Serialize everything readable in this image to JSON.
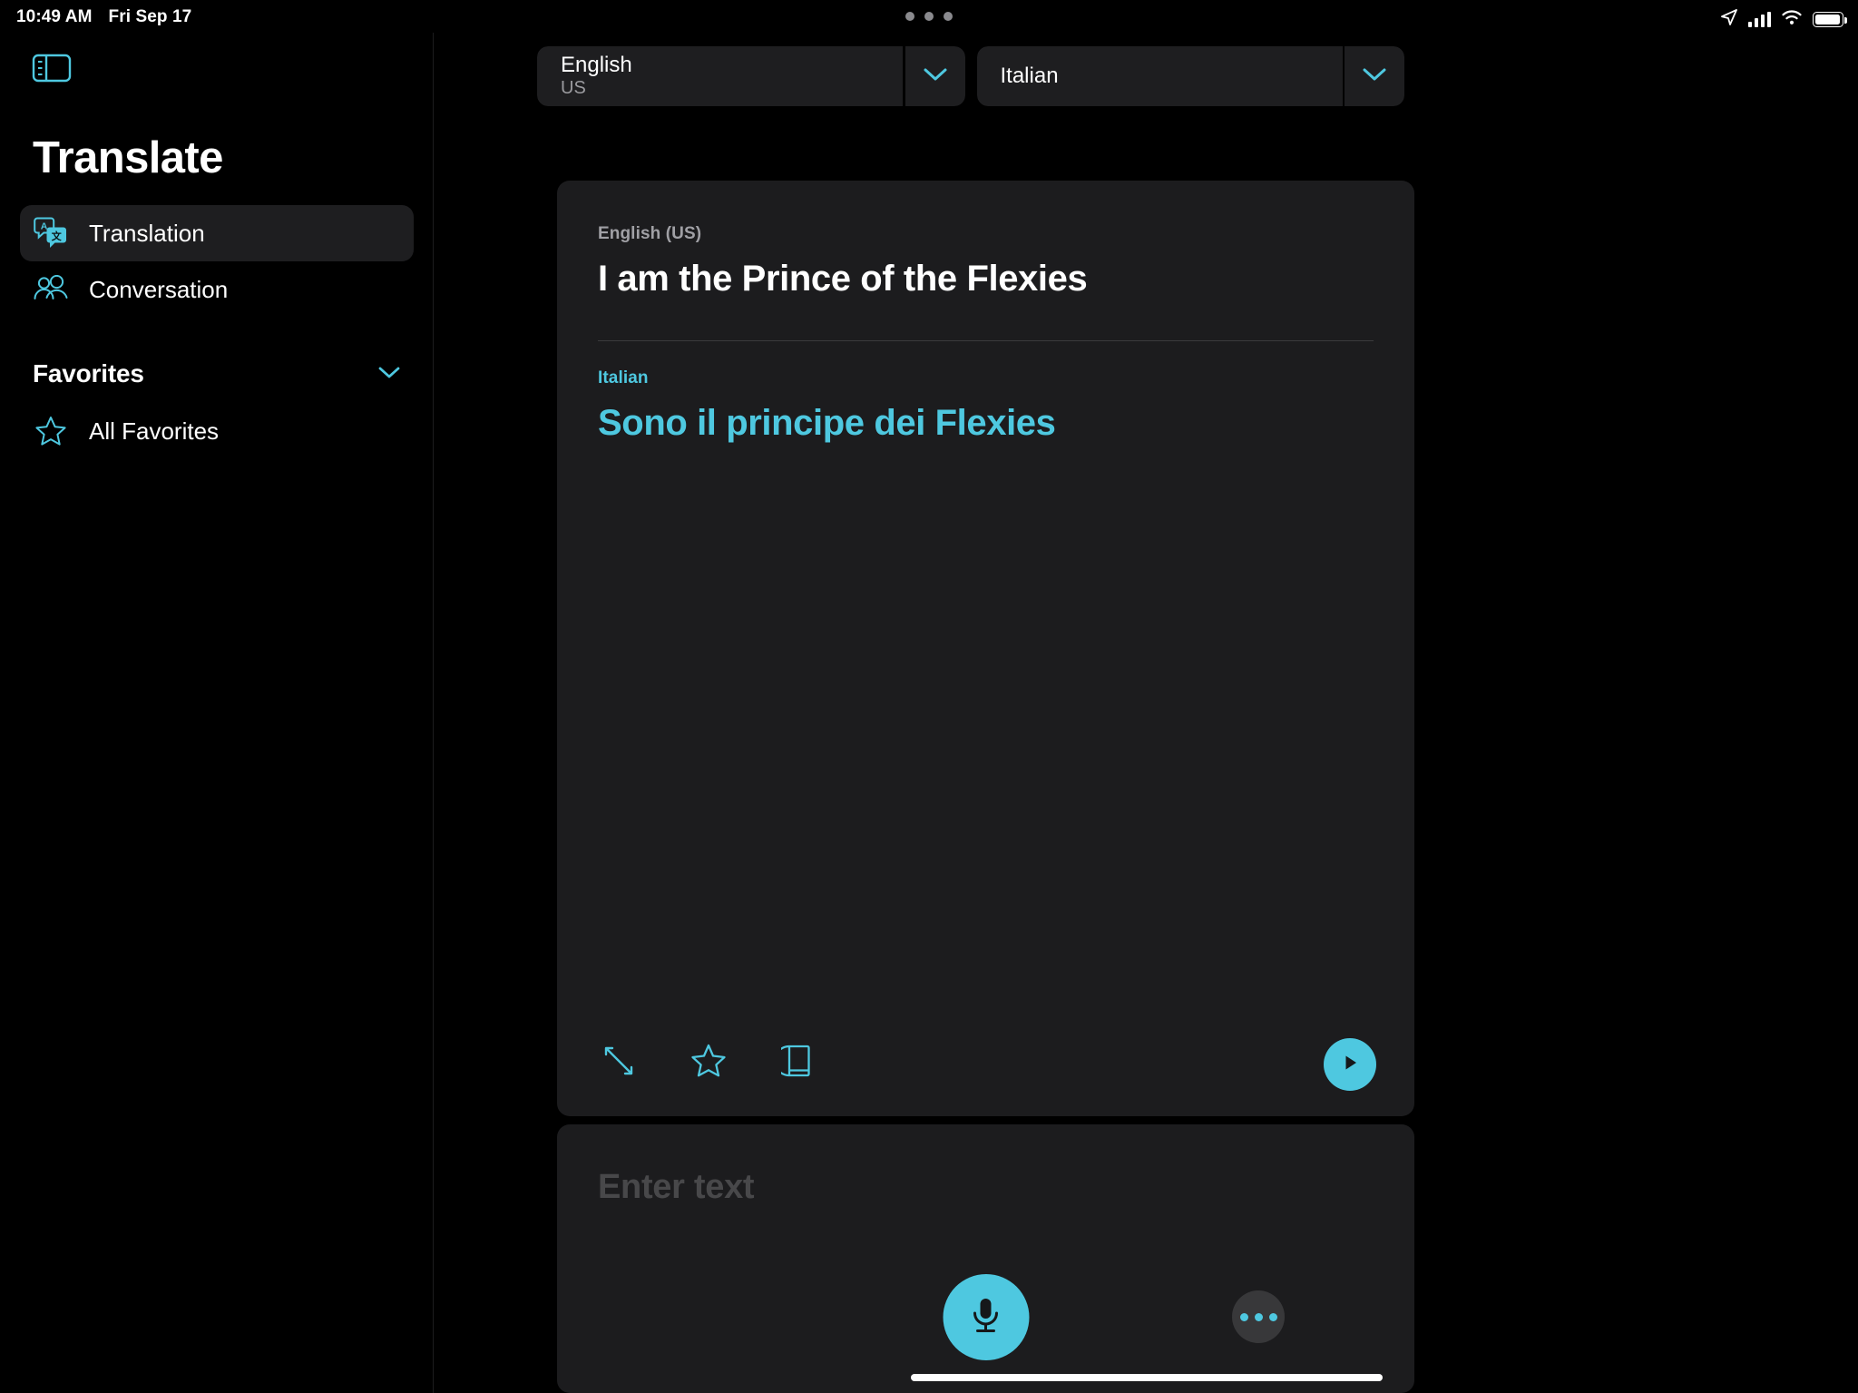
{
  "status_bar": {
    "time": "10:49 AM",
    "date": "Fri Sep 17",
    "icons": [
      "location-arrow-icon",
      "cellular-bars-icon",
      "wifi-icon",
      "battery-icon"
    ],
    "multitask_dots": "•••"
  },
  "sidebar": {
    "toggle_icon": "sidebar-toggle-icon",
    "title": "Translate",
    "items": [
      {
        "label": "Translation",
        "icon": "translation-bubbles-icon",
        "selected": true
      },
      {
        "label": "Conversation",
        "icon": "two-people-icon",
        "selected": false
      }
    ],
    "favorites": {
      "header": "Favorites",
      "chevron_icon": "chevron-down-icon",
      "items": [
        {
          "label": "All Favorites",
          "icon": "star-outline-icon"
        }
      ]
    }
  },
  "language_bar": {
    "source": {
      "name": "English",
      "region": "US",
      "chevron_icon": "chevron-down-icon"
    },
    "target": {
      "name": "Italian",
      "region": "",
      "chevron_icon": "chevron-down-icon"
    }
  },
  "translation_card": {
    "source_label": "English (US)",
    "source_text": "I am the Prince of the Flexies",
    "target_label": "Italian",
    "target_text": "Sono il principe dei Flexies",
    "tools": [
      {
        "name": "expand-icon"
      },
      {
        "name": "star-icon"
      },
      {
        "name": "dictionary-book-icon"
      }
    ],
    "play_icon": "play-icon"
  },
  "input_card": {
    "placeholder": "Enter text",
    "mic_icon": "microphone-icon",
    "more_icon": "more-dots-icon"
  },
  "colors": {
    "accent": "#4ec8e0",
    "background": "#000000",
    "card": "#1c1c1e",
    "selected_row": "#1e1e20"
  }
}
